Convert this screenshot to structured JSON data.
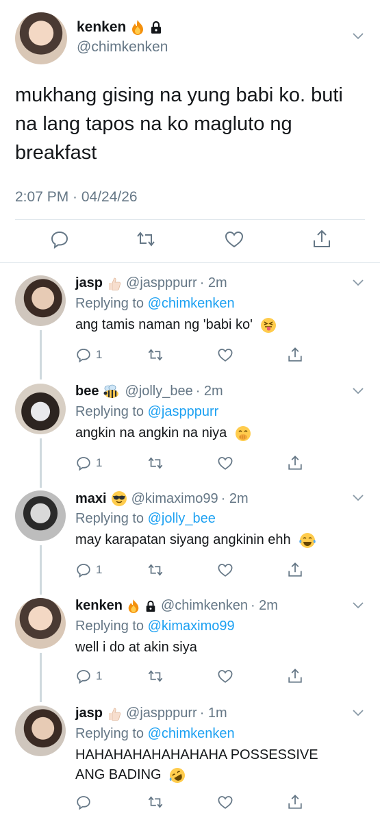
{
  "main_tweet": {
    "name": "kenken",
    "badges": [
      "fire-emoji",
      "lock-icon"
    ],
    "handle": "@chimkenken",
    "text": "mukhang gising na yung babi ko. buti na lang tapos na ko magluto ng breakfast",
    "timestamp": "2:07 PM · 04/24/26"
  },
  "replies": [
    {
      "name": "jasp",
      "emoji": "thumbs-up-light-skin",
      "handle": "@jaspppurr",
      "time": "· 2m",
      "replying_prefix": "Replying to ",
      "replying_to": "@chimkenken",
      "text": "ang tamis naman ng 'babi ko'",
      "text_emoji": "squinting-tongue-face",
      "reply_count": "1"
    },
    {
      "name": "bee",
      "emoji": "bee",
      "handle": "@jolly_bee",
      "time": "· 2m",
      "replying_prefix": "Replying to ",
      "replying_to": "@jaspppurr",
      "text": "angkin na angkin na niya",
      "text_emoji": "face-with-hand-over-mouth",
      "reply_count": "1"
    },
    {
      "name": "maxi",
      "emoji": "smiling-face-with-sunglasses",
      "handle": "@kimaximo99",
      "time": "· 2m",
      "replying_prefix": "Replying to ",
      "replying_to": "@jolly_bee",
      "text": "may karapatan siyang angkinin ehh",
      "text_emoji": "face-with-tears-of-joy",
      "reply_count": "1"
    },
    {
      "name": "kenken",
      "emoji": "fire-and-lock",
      "handle": "@chimkenken",
      "time": "· 2m",
      "replying_prefix": "Replying to ",
      "replying_to": "@kimaximo99",
      "text": "well i do at akin siya",
      "text_emoji": "",
      "reply_count": "1"
    },
    {
      "name": "jasp",
      "emoji": "thumbs-up-light-skin",
      "handle": "@jaspppurr",
      "time": "· 1m",
      "replying_prefix": "Replying to ",
      "replying_to": "@chimkenken",
      "text": "HAHAHAHAHAHAHAHA POSSESSIVE ANG BADING",
      "text_emoji": "rolling-on-floor-laughing",
      "reply_count": ""
    }
  ],
  "colors": {
    "text": "#14171a",
    "secondary": "#657786",
    "link": "#1da1f2",
    "divider": "#e1e8ed"
  }
}
